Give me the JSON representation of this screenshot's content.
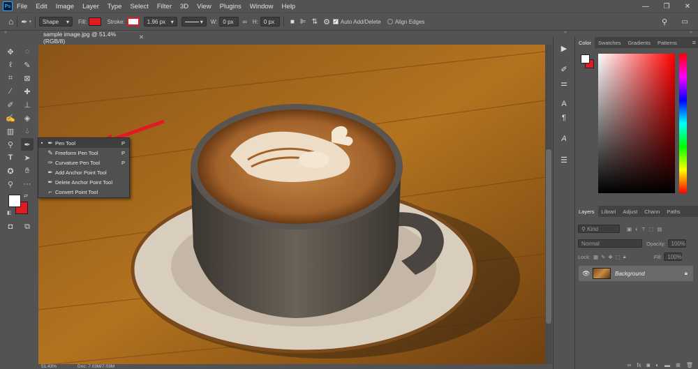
{
  "app": {
    "logo": "Ps"
  },
  "menu": [
    "File",
    "Edit",
    "Image",
    "Layer",
    "Type",
    "Select",
    "Filter",
    "3D",
    "View",
    "Plugins",
    "Window",
    "Help"
  ],
  "window_controls": {
    "minimize": "—",
    "maximize": "❐",
    "close": "✕"
  },
  "options": {
    "shape_mode": "Shape",
    "fill_label": "Fill:",
    "fill_color": "#e21b22",
    "stroke_label": "Stroke:",
    "stroke_width": "1.96 px",
    "w_label": "W:",
    "w_value": "0 px",
    "h_label": "H:",
    "h_value": "0 px",
    "auto_add_delete": "Auto Add/Delete",
    "align_edges": "Align Edges"
  },
  "document": {
    "tab_title": "sample image.jpg @ 51.4% (RGB/8)",
    "zoom_status": "51.43%",
    "doc_status": "Doc: 7.03M/7.03M"
  },
  "flyout": [
    {
      "label": "Pen Tool",
      "key": "P",
      "selected": true,
      "icon": "pen-icon"
    },
    {
      "label": "Freeform Pen Tool",
      "key": "P",
      "selected": false,
      "icon": "freeform-pen-icon"
    },
    {
      "label": "Curvature Pen Tool",
      "key": "P",
      "selected": false,
      "icon": "curvature-pen-icon"
    },
    {
      "label": "Add Anchor Point Tool",
      "key": "",
      "selected": false,
      "icon": "add-anchor-icon"
    },
    {
      "label": "Delete Anchor Point Tool",
      "key": "",
      "selected": false,
      "icon": "delete-anchor-icon"
    },
    {
      "label": "Convert Point Tool",
      "key": "",
      "selected": false,
      "icon": "convert-point-icon"
    }
  ],
  "color_panel": {
    "tabs": [
      "Color",
      "Swatches",
      "Gradients",
      "Patterns"
    ],
    "foreground": "#ffffff",
    "background": "#e21b22"
  },
  "layers_panel": {
    "tabs": [
      "Layers",
      "Librari",
      "Adjust",
      "Chann",
      "Paths"
    ],
    "filter_kind": "Kind",
    "blend_mode": "Normal",
    "opacity_label": "Opacity:",
    "opacity_value": "100%",
    "lock_label": "Lock:",
    "fill_label": "Fill:",
    "fill_value": "100%",
    "layers": [
      {
        "name": "Background",
        "visible": true,
        "locked": true
      }
    ]
  }
}
